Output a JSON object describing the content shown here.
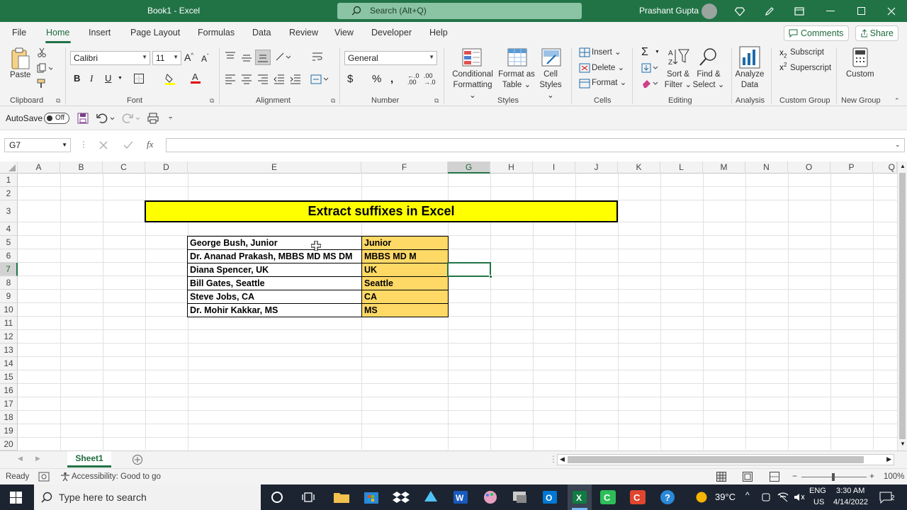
{
  "titlebar": {
    "doc_title": "Book1 - Excel",
    "search_placeholder": "Search (Alt+Q)",
    "user_name": "Prashant Gupta"
  },
  "tabs": [
    "File",
    "Home",
    "Insert",
    "Page Layout",
    "Formulas",
    "Data",
    "Review",
    "View",
    "Developer",
    "Help"
  ],
  "active_tab": "Home",
  "top_buttons": {
    "comments": "Comments",
    "share": "Share"
  },
  "ribbon": {
    "clipboard": {
      "paste": "Paste",
      "group": "Clipboard"
    },
    "font": {
      "name": "Calibri",
      "size": "11",
      "group": "Font"
    },
    "alignment": {
      "group": "Alignment"
    },
    "number": {
      "format": "General",
      "group": "Number"
    },
    "styles": {
      "cond1": "Conditional",
      "cond2": "Formatting",
      "fat1": "Format as",
      "fat2": "Table",
      "cs1": "Cell",
      "cs2": "Styles",
      "group": "Styles"
    },
    "cells": {
      "insert": "Insert",
      "delete": "Delete",
      "format": "Format",
      "group": "Cells"
    },
    "editing": {
      "sort1": "Sort &",
      "sort2": "Filter",
      "find1": "Find &",
      "find2": "Select",
      "group": "Editing"
    },
    "analysis": {
      "a1": "Analyze",
      "a2": "Data",
      "group": "Analysis"
    },
    "custom_group": {
      "subscript": "Subscript",
      "superscript": "Superscript",
      "group": "Custom Group"
    },
    "new_group": {
      "custom": "Custom",
      "group": "New Group"
    },
    "accent": "#217346"
  },
  "qat": {
    "autosave": "AutoSave",
    "toggle": "Off"
  },
  "formula_bar": {
    "name_box": "G7",
    "fx": "fx",
    "formula": ""
  },
  "columns": [
    "A",
    "B",
    "C",
    "D",
    "E",
    "F",
    "G",
    "H",
    "I",
    "J",
    "K",
    "L",
    "M",
    "N",
    "O",
    "P"
  ],
  "selected_column": "G",
  "rows": [
    "1",
    "2",
    "3",
    "4",
    "5",
    "6",
    "7",
    "8",
    "9",
    "10",
    "11",
    "12",
    "13",
    "14",
    "15",
    "16",
    "17",
    "18",
    "19",
    "20"
  ],
  "selected_row": "7",
  "sheet": {
    "title": "Extract suffixes in Excel",
    "title_fill": "#ffff00",
    "data": [
      {
        "full": "George Bush, Junior",
        "suffix": "Junior"
      },
      {
        "full": "Dr. Ananad Prakash, MBBS MD MS DM",
        "suffix": "MBBS MD M"
      },
      {
        "full": "Diana Spencer, UK",
        "suffix": "UK"
      },
      {
        "full": "Bill Gates, Seattle",
        "suffix": "Seattle"
      },
      {
        "full": "Steve Jobs, CA",
        "suffix": "CA"
      },
      {
        "full": "Dr. Mohir Kakkar, MS",
        "suffix": "MS"
      }
    ],
    "suffix_fill": "#ffd966"
  },
  "sheet_tabs": [
    "Sheet1"
  ],
  "status": {
    "ready": "Ready",
    "accessibility": "Accessibility: Good to go",
    "zoom": "100%"
  },
  "taskbar": {
    "search_placeholder": "Type here to search",
    "temp": "39°C",
    "lang1": "ENG",
    "lang2": "US",
    "time": "3:30 AM",
    "date": "4/14/2022",
    "notif_count": "2"
  }
}
